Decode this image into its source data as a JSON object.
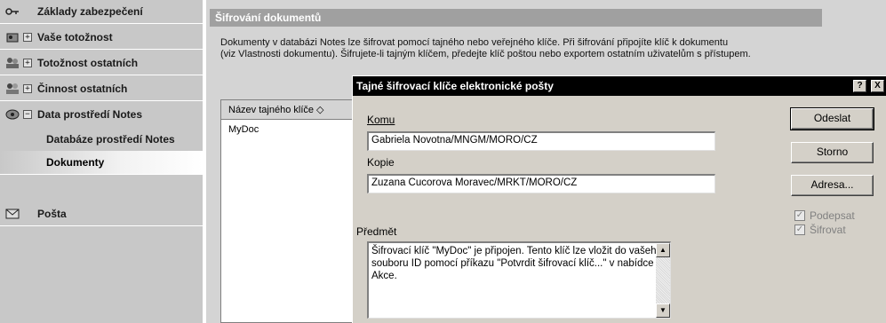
{
  "sidebar": {
    "items": [
      {
        "icon": "key-icon",
        "label": "Základy zabezpečení",
        "expander": ""
      },
      {
        "icon": "id-card-icon",
        "label": "Vaše totožnost",
        "expander": "+"
      },
      {
        "icon": "people-icon",
        "label": "Totožnost ostatních",
        "expander": "+"
      },
      {
        "icon": "people-activity-icon",
        "label": "Činnost ostatních",
        "expander": "+"
      },
      {
        "icon": "notes-environment-icon",
        "label": "Data prostředí Notes",
        "expander": "−"
      },
      {
        "icon": "mail-icon",
        "label": "Pošta",
        "expander": ""
      }
    ],
    "subitems": [
      {
        "label": "Databáze prostředí Notes",
        "selected": false
      },
      {
        "label": "Dokumenty",
        "selected": true
      }
    ]
  },
  "main": {
    "section_title": "Šifrování dokumentů",
    "description": [
      "Dokumenty v databázi Notes lze šifrovat pomocí tajného nebo veřejného klíče. Při šifrování připojíte klíč k dokumentu",
      "(viz Vlastnosti dokumentu). Šifrujete-li tajným klíčem, předejte klíč poštou nebo exportem ostatním uživatelům s přístupem."
    ],
    "list": {
      "header": "Název tajného klíče ◇",
      "rows": [
        "MyDoc"
      ]
    }
  },
  "dialog": {
    "title": "Tajné šifrovací klíče elektronické pošty",
    "help_label": "?",
    "close_label": "X",
    "to_label": "Komu",
    "to_value": "Gabriela Novotna/MNGM/MORO/CZ",
    "cc_label": "Kopie",
    "cc_value": "Zuzana Cucorova Moravec/MRKT/MORO/CZ",
    "subject_label": "Předmět",
    "body_lines": [
      "Šifrovací klíč \"MyDoc\" je připojen. Tento klíč lze vložit do vašeho",
      "souboru ID pomocí příkazu \"Potvrdit šifrovací klíč...\" v nabídce",
      "Akce."
    ],
    "buttons": {
      "send": "Odeslat",
      "cancel": "Storno",
      "address": "Adresa..."
    },
    "checkboxes": {
      "sign": {
        "label": "Podepsat",
        "checked": true
      },
      "encrypt": {
        "label": "Šifrovat",
        "checked": true
      }
    }
  }
}
